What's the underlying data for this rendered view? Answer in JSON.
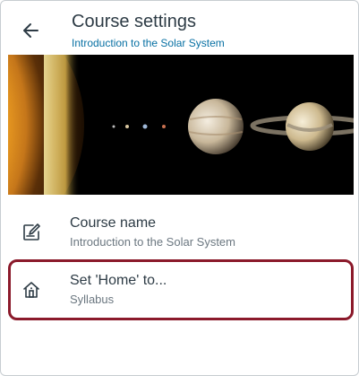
{
  "header": {
    "title": "Course settings",
    "subtitle": "Introduction to the Solar System"
  },
  "settings": [
    {
      "label": "Course name",
      "value": "Introduction to the Solar System",
      "icon": "edit-icon"
    },
    {
      "label": "Set 'Home' to...",
      "value": "Syllabus",
      "icon": "home-icon"
    }
  ],
  "colors": {
    "title": "#2d3b45",
    "link": "#0770a3",
    "secondary": "#6b7780",
    "highlight": "#8b1a2b"
  }
}
